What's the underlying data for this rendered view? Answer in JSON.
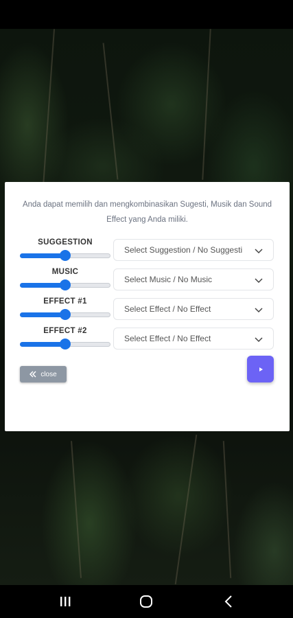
{
  "description": "Anda dapat memilih dan mengkombinasikan Sugesti, Musik dan Sound Effect yang Anda miliki.",
  "rows": [
    {
      "label": "SUGGESTION",
      "select": "Select Suggestion / No Suggesti",
      "volume": 0.5
    },
    {
      "label": "MUSIC",
      "select": "Select Music / No Music",
      "volume": 0.5
    },
    {
      "label": "EFFECT #1",
      "select": "Select Effect / No Effect",
      "volume": 0.5
    },
    {
      "label": "EFFECT #2",
      "select": "Select Effect / No Effect",
      "volume": 0.5
    }
  ],
  "close_label": "close",
  "icons": {
    "close": "double-chevron-left-icon",
    "play": "play-icon",
    "select": "chevron-down-icon",
    "nav_recent": "recent-apps-icon",
    "nav_home": "home-icon",
    "nav_back": "back-icon"
  },
  "colors": {
    "accent": "#1a73e8",
    "play_button": "#6c63f5",
    "close_button": "#8d97a3"
  }
}
